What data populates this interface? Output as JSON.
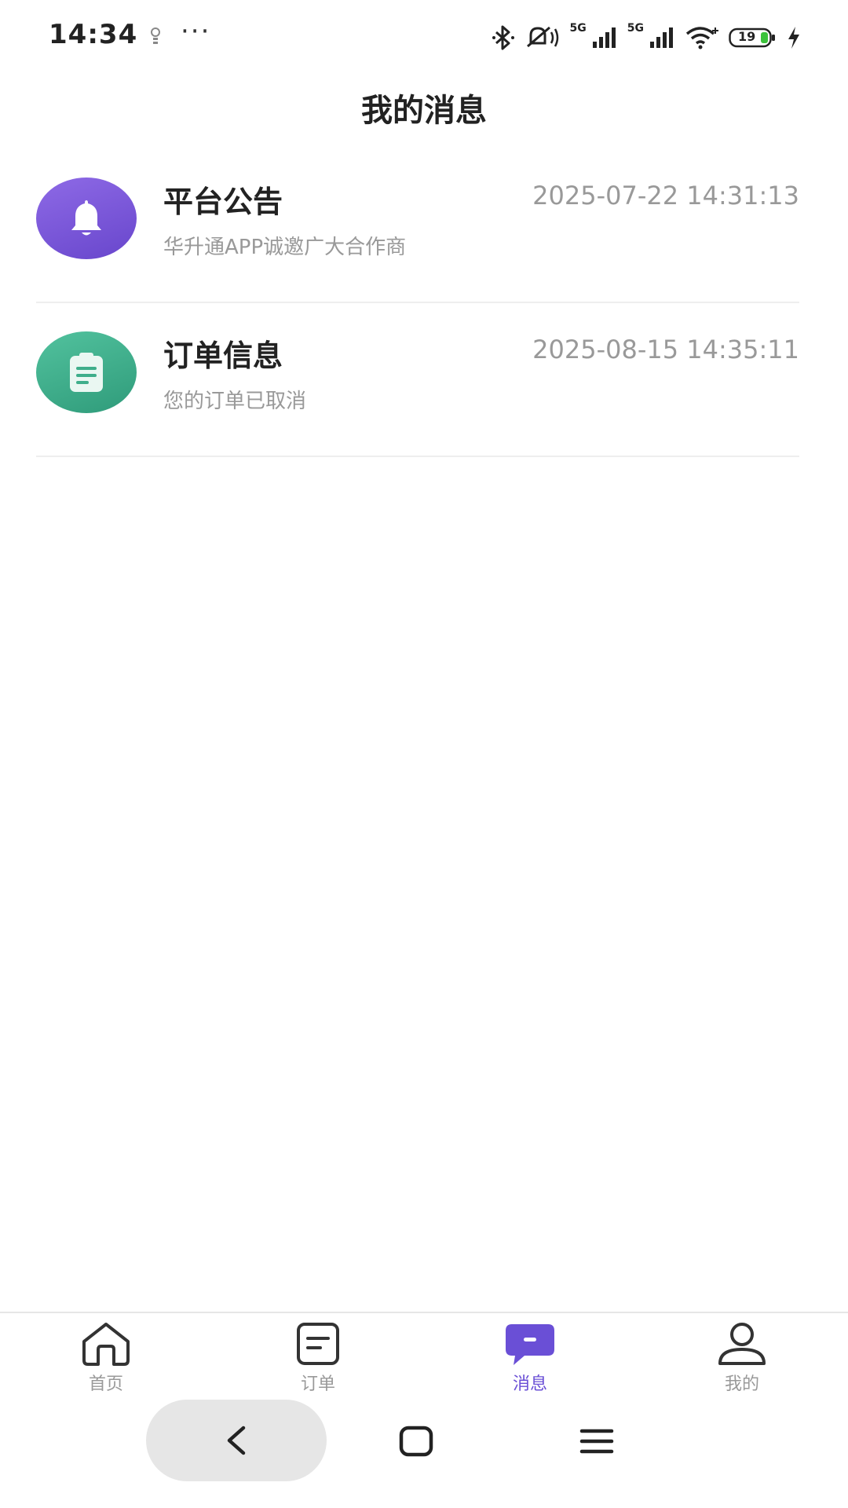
{
  "status_bar": {
    "time": "14:34",
    "dots": "···",
    "signal1_label": "5G",
    "signal2_label": "5G",
    "battery": "19",
    "icons": [
      "bulb-icon",
      "bluetooth-icon",
      "mute-icon",
      "signal-icon",
      "signal-icon",
      "wifi-icon",
      "battery-icon",
      "charging-icon"
    ]
  },
  "header": {
    "title": "我的消息"
  },
  "messages": [
    {
      "title": "平台公告",
      "time": "2025-07-22 14:31:13",
      "subtitle": "华升通APP诚邀广大合作商",
      "icon": "bell-icon",
      "color": "#7a57dc"
    },
    {
      "title": "订单信息",
      "time": "2025-08-15 14:35:11",
      "subtitle": "您的订单已取消",
      "icon": "clipboard-icon",
      "color": "#3fae8b"
    }
  ],
  "tabs": [
    {
      "label": "首页",
      "icon": "home-icon",
      "active": false
    },
    {
      "label": "订单",
      "icon": "order-icon",
      "active": false
    },
    {
      "label": "消息",
      "icon": "message-icon",
      "active": true
    },
    {
      "label": "我的",
      "icon": "profile-icon",
      "active": false
    }
  ],
  "accent_color": "#6a4fd6",
  "nav_icons": [
    "back-icon",
    "home-square-icon",
    "menu-icon"
  ]
}
